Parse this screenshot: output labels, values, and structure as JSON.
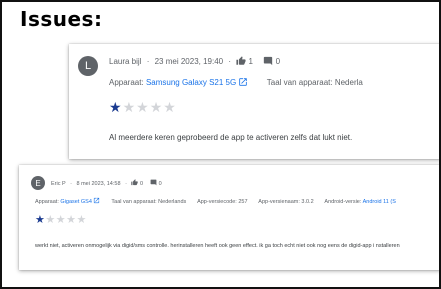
{
  "heading": "Issues:",
  "reviews": [
    {
      "avatar": "L",
      "author": "Laura bijl",
      "date": "23 mei 2023, 19:40",
      "likes": "1",
      "replies": "0",
      "device_label": "Apparaat:",
      "device": "Samsung Galaxy S21 5G",
      "language_label": "Taal van apparaat: Nederla",
      "stars": [
        "★",
        "★",
        "★",
        "★",
        "★"
      ],
      "rating": 1,
      "text": "Al meerdere keren geprobeerd de app te activeren zelfs dat lukt niet."
    },
    {
      "avatar": "E",
      "author": "Eric P",
      "date": "8 mei 2023, 14:58",
      "likes": "0",
      "replies": "0",
      "device_label": "Apparaat:",
      "device": "Gigaset GS4",
      "language_label": "Taal van apparaat: Nederlands",
      "app_version_code": "App-versiecode: 257",
      "app_version_name": "App-versienaam: 3.0.2",
      "android_label": "Android-versie:",
      "android_version": "Android 11 (S",
      "stars": [
        "★",
        "★",
        "★",
        "★",
        "★"
      ],
      "rating": 1,
      "text": "werkt niet, activeren onmogelijk via digid/sms controlle. herinstalleren heeft ook geen effect. ik ga toch echt niet ook nog eens de digid-app i nstalleren"
    }
  ],
  "colors": {
    "star_filled": "#1a3a8f",
    "star_empty": "#d3d5d9",
    "link": "#1a73e8"
  },
  "icons": {
    "like": "thumbs-up-icon",
    "reply": "reply-icon",
    "open": "open-in-new-icon"
  }
}
